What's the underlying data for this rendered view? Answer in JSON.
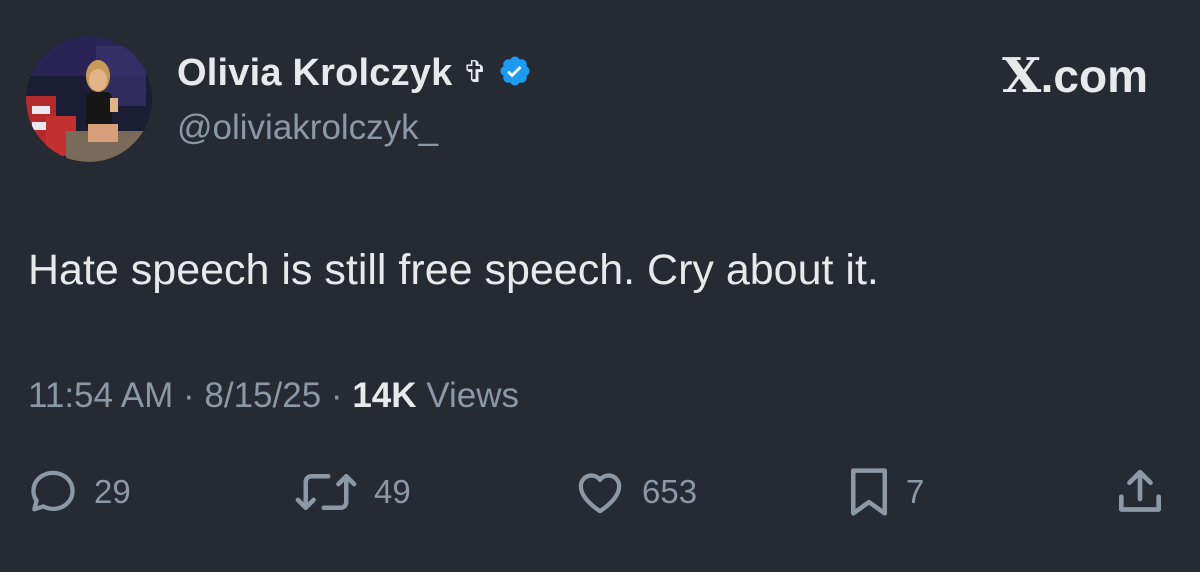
{
  "header": {
    "display_name": "Olivia Krolczyk",
    "name_emoji": "✞",
    "handle": "@oliviakrolczyk_",
    "verified_icon": "verified-badge-icon",
    "site_label": ".com",
    "site_logo": "X"
  },
  "tweet": {
    "text": "Hate speech is still free speech. Cry about it."
  },
  "meta": {
    "time": "11:54 AM",
    "separator": "·",
    "date": "8/15/25",
    "views_count": "14K",
    "views_label": "Views"
  },
  "actions": {
    "reply_count": "29",
    "retweet_count": "49",
    "like_count": "653",
    "bookmark_count": "7"
  },
  "colors": {
    "background": "#252a33",
    "text": "#e7e9ea",
    "muted": "#8b98a5",
    "verified": "#1d9bf0"
  }
}
